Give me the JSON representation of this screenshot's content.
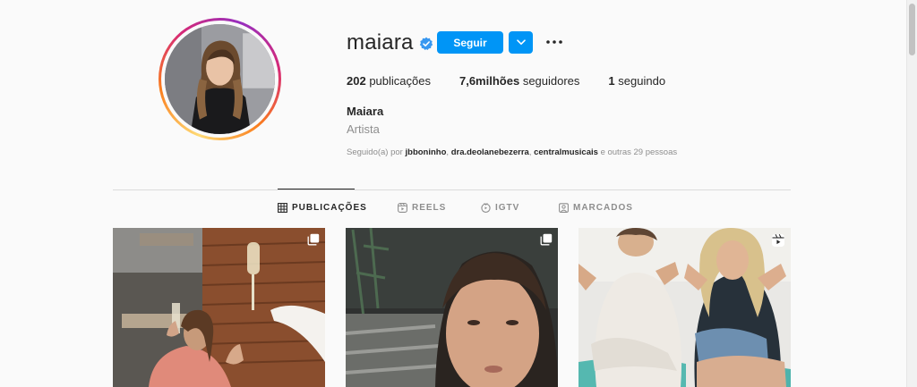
{
  "profile": {
    "username": "maiara",
    "verified_icon": "verified-badge-icon",
    "follow_label": "Seguir",
    "stats": {
      "posts_count": "202",
      "posts_label": "publicações",
      "followers_count": "7,6milhões",
      "followers_label": "seguidores",
      "following_count": "1",
      "following_label": "seguindo"
    },
    "full_name": "Maiara",
    "category": "Artista",
    "followed_by": {
      "prefix": "Seguido(a) por",
      "user1": "jbboninho",
      "sep1": ",",
      "user2": "dra.deolanebezerra",
      "sep2": ",",
      "user3": "centralmusicais",
      "suffix": "e outras 29 pessoas"
    }
  },
  "tabs": [
    {
      "label": "PUBLICAÇÕES",
      "icon": "grid-icon",
      "active": true
    },
    {
      "label": "REELS",
      "icon": "reels-icon",
      "active": false
    },
    {
      "label": "IGTV",
      "icon": "igtv-icon",
      "active": false
    },
    {
      "label": "MARCADOS",
      "icon": "tagged-icon",
      "active": false
    }
  ],
  "posts": [
    {
      "type": "carousel",
      "badge_icon": "carousel-icon",
      "scene": "toast-with-wine-glasses"
    },
    {
      "type": "carousel",
      "badge_icon": "carousel-icon",
      "scene": "selfie-outdoor-night"
    },
    {
      "type": "reel",
      "badge_icon": "reels-icon",
      "scene": "two-women-waving-hands"
    }
  ],
  "colors": {
    "accent": "#0095f6",
    "text_primary": "#262626",
    "text_secondary": "#8e8e8e",
    "background": "#fafafa",
    "divider": "#dbdbdb"
  }
}
